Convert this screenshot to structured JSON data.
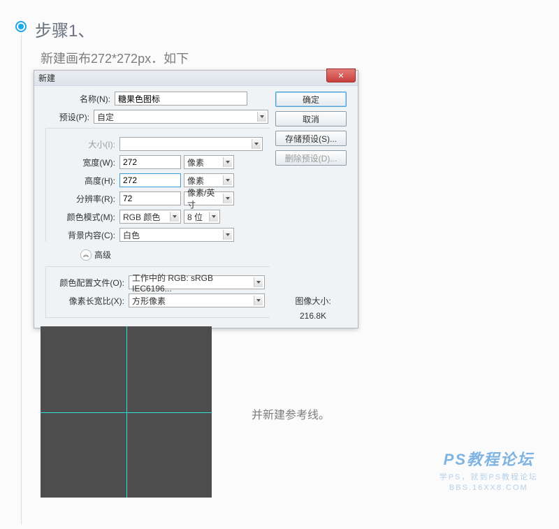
{
  "step": {
    "title": "步骤1、",
    "subtitle": "新建画布272*272px．如下"
  },
  "dialog": {
    "title": "新建",
    "labels": {
      "name": "名称(N):",
      "preset": "预设(P):",
      "size": "大小(I):",
      "width": "宽度(W):",
      "height": "高度(H):",
      "resolution": "分辨率(R):",
      "color_mode": "颜色模式(M):",
      "bg_content": "背景内容(C):",
      "advanced": "高级",
      "color_profile": "颜色配置文件(O):",
      "pixel_aspect": "像素长宽比(X):"
    },
    "values": {
      "name": "糖果色图标",
      "preset": "自定",
      "size": "",
      "width": "272",
      "height": "272",
      "resolution": "72",
      "color_mode": "RGB 颜色",
      "bit_depth": "8 位",
      "bg_content": "白色",
      "color_profile": "工作中的 RGB: sRGB IEC6196...",
      "pixel_aspect": "方形像素"
    },
    "units": {
      "width": "像素",
      "height": "像素",
      "resolution": "像素/英寸"
    },
    "buttons": {
      "ok": "确定",
      "cancel": "取消",
      "save_preset": "存储预设(S)...",
      "delete_preset": "删除预设(D)..."
    },
    "image_size": {
      "label": "图像大小:",
      "value": "216.8K"
    },
    "advanced_toggle": "︽"
  },
  "guide_caption": "并新建参考线。",
  "watermark": {
    "title": "PS教程论坛",
    "sub": "学PS，就到PS教程论坛",
    "url": "BBS.16XX8.COM"
  }
}
